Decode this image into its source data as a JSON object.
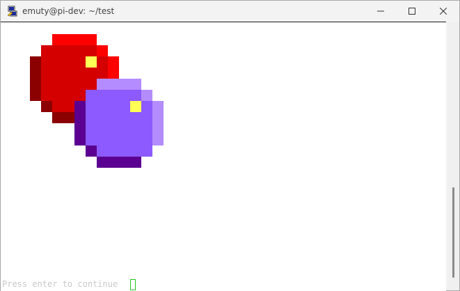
{
  "window": {
    "title": "emuty@pi-dev: ~/test"
  },
  "controls": {
    "minimize": "minimize-icon",
    "maximize": "maximize-icon",
    "close": "close-icon"
  },
  "terminal": {
    "prompt_text": "Press enter to continue",
    "sprites": [
      {
        "name": "red-ball",
        "colors": {
          "dark": "#8b0000",
          "mid": "#d40000",
          "light": "#ff0000",
          "highlight": "#ffff55"
        }
      },
      {
        "name": "purple-ball",
        "colors": {
          "dark": "#5b0090",
          "mid": "#8c5aff",
          "light": "#b48cff",
          "highlight": "#ffff55"
        }
      }
    ]
  }
}
